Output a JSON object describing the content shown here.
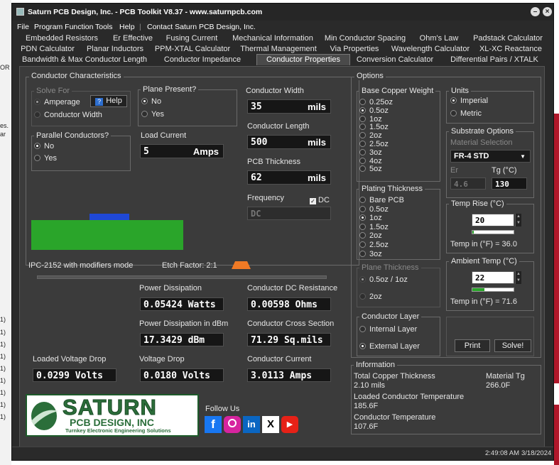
{
  "window": {
    "title": "Saturn PCB Design, Inc. - PCB Toolkit V8.37 - www.saturnpcb.com",
    "minimize_glyph": "–",
    "close_glyph": "×"
  },
  "menu": [
    "File",
    "Program Function",
    "Tools",
    "Help",
    "|",
    "Contact Saturn PCB Design, Inc."
  ],
  "tabs": {
    "row1": [
      "Embedded Resistors",
      "Er Effective",
      "Fusing Current",
      "Mechanical Information",
      "Min Conductor Spacing",
      "Ohm's Law",
      "Padstack Calculator"
    ],
    "row2": [
      "PDN Calculator",
      "Planar Inductors",
      "PPM-XTAL Calculator",
      "Thermal Management",
      "Via Properties",
      "Wavelength Calculator",
      "XL-XC Reactance"
    ],
    "row3": [
      "Bandwidth & Max Conductor Length",
      "Conductor Impedance",
      "Conductor Properties",
      "Conversion Calculator",
      "Differential Pairs / XTALK"
    ],
    "active": "Conductor Properties"
  },
  "characteristics": {
    "title": "Conductor Characteristics",
    "solve_for": {
      "title": "Solve For",
      "options": [
        "Amperage",
        "Conductor Width"
      ],
      "help_label": "Help",
      "help_glyph": "?"
    },
    "plane_present": {
      "title": "Plane Present?",
      "options": [
        "No",
        "Yes"
      ],
      "selected": "No"
    },
    "parallel": {
      "title": "Parallel Conductors?",
      "options": [
        "No",
        "Yes"
      ],
      "selected": "No"
    },
    "load_current": {
      "label": "Load Current",
      "value": "5",
      "unit": "Amps"
    },
    "conductor_width": {
      "label": "Conductor Width",
      "value": "35",
      "unit": "mils"
    },
    "conductor_length": {
      "label": "Conductor Length",
      "value": "500",
      "unit": "mils"
    },
    "pcb_thickness": {
      "label": "PCB Thickness",
      "value": "62",
      "unit": "mils"
    },
    "frequency": {
      "label": "Frequency",
      "dc_label": "DC",
      "value": "DC",
      "dc_checked": true
    },
    "mode_text": "IPC-2152 with modifiers mode",
    "etch_factor": "Etch Factor: 2:1",
    "colors": {
      "board": "#2aa52a",
      "trace": "#1f48d6",
      "etch": "#f07a25"
    }
  },
  "results": {
    "power_dissipation": {
      "label": "Power Dissipation",
      "value": "0.05424 Watts"
    },
    "dc_resistance": {
      "label": "Conductor DC Resistance",
      "value": "0.00598 Ohms"
    },
    "power_dbm": {
      "label": "Power Dissipation in dBm",
      "value": "17.3429 dBm"
    },
    "cross_section": {
      "label": "Conductor Cross Section",
      "value": "71.29 Sq.mils"
    },
    "loaded_voltage_drop": {
      "label": "Loaded Voltage Drop",
      "value": "0.0299 Volts"
    },
    "voltage_drop": {
      "label": "Voltage Drop",
      "value": "0.0180 Volts"
    },
    "conductor_current": {
      "label": "Conductor Current",
      "value": "3.0113 Amps"
    }
  },
  "branding": {
    "logo_main": "SATURN",
    "logo_sub": "PCB DESIGN, INC",
    "logo_tag": "Turnkey Electronic Engineering Solutions",
    "follow_us": "Follow Us",
    "social": [
      "f",
      "ig",
      "in",
      "X",
      "▶"
    ]
  },
  "options": {
    "title": "Options",
    "base_copper": {
      "title": "Base Copper Weight",
      "options": [
        "0.25oz",
        "0.5oz",
        "1oz",
        "1.5oz",
        "2oz",
        "2.5oz",
        "3oz",
        "4oz",
        "5oz"
      ],
      "selected": "0.5oz"
    },
    "units": {
      "title": "Units",
      "options": [
        "Imperial",
        "Metric"
      ],
      "selected": "Imperial"
    },
    "substrate": {
      "title": "Substrate Options",
      "material_label": "Material Selection",
      "material": "FR-4 STD",
      "er_label": "Er",
      "er_value": "4.6",
      "tg_label": "Tg (°C)",
      "tg_value": "130"
    },
    "plating": {
      "title": "Plating Thickness",
      "options": [
        "Bare PCB",
        "0.5oz",
        "1oz",
        "1.5oz",
        "2oz",
        "2.5oz",
        "3oz"
      ],
      "selected": "1oz"
    },
    "temp_rise": {
      "title": "Temp Rise (°C)",
      "value": "20",
      "level": 0.03,
      "fahrenheit": "Temp in (°F) = 36.0"
    },
    "plane_thickness": {
      "title": "Plane Thickness",
      "options": [
        "0.5oz / 1oz",
        "2oz"
      ]
    },
    "ambient": {
      "title": "Ambient Temp (°C)",
      "value": "22",
      "level": 0.3,
      "fahrenheit": "Temp in (°F) = 71.6"
    },
    "layer": {
      "title": "Conductor Layer",
      "options": [
        "Internal Layer",
        "External Layer"
      ],
      "selected": "External Layer"
    },
    "print_label": "Print",
    "solve_label": "Solve!"
  },
  "information": {
    "title": "Information",
    "total_copper_label": "Total Copper Thickness",
    "total_copper": "2.10 mils",
    "material_tg_label": "Material Tg",
    "material_tg": "266.0F",
    "loaded_temp_label": "Loaded Conductor Temperature",
    "loaded_temp": "185.6F",
    "conductor_temp_label": "Conductor Temperature",
    "conductor_temp": "107.6F"
  },
  "status": {
    "time": "2:49:08 AM",
    "date": "3/18/2024"
  },
  "background_left": [
    "OR",
    "es.",
    "ar",
    "1)",
    "1)",
    "1)",
    "1)",
    "1)",
    "1)",
    "1)",
    "1)",
    "1)"
  ]
}
